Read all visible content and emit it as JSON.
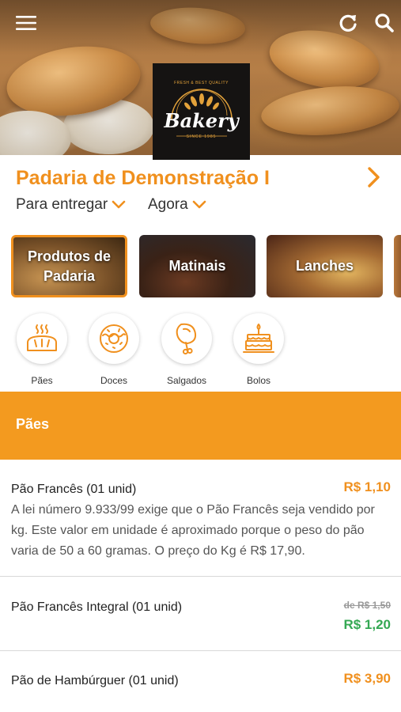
{
  "header": {
    "menu_icon": "hamburger-menu-icon",
    "refresh_icon": "refresh-icon",
    "search_icon": "search-icon",
    "logo": {
      "tagline": "FRESH & BEST QUALITY",
      "name": "Bakery",
      "since": "SINCE 1985"
    }
  },
  "store": {
    "name": "Padaria de Demonstração I",
    "delivery_mode": "Para entregar",
    "schedule": "Agora"
  },
  "categories": [
    {
      "label_line1": "Produtos de",
      "label_line2": "Padaria",
      "active": true
    },
    {
      "label_line1": "Matinais",
      "label_line2": "",
      "active": false
    },
    {
      "label_line1": "Lanches",
      "label_line2": "",
      "active": false
    }
  ],
  "subcategories": [
    {
      "label": "Pães",
      "icon": "bread-icon"
    },
    {
      "label": "Doces",
      "icon": "donut-icon"
    },
    {
      "label": "Salgados",
      "icon": "chicken-leg-icon"
    },
    {
      "label": "Bolos",
      "icon": "cake-icon"
    }
  ],
  "section": {
    "title": "Pães"
  },
  "products": [
    {
      "name": "Pão Francês (01 unid)",
      "price": "R$ 1,10",
      "description": "A lei número 9.933/99 exige que o Pão Francês seja vendido por kg. Este valor em unidade é aproximado porque o peso do pão varia de 50 a 60 gramas. O preço do Kg é R$ 17,90."
    },
    {
      "name": "Pão Francês Integral (01 unid)",
      "old_price": "de R$ 1,50",
      "price": "R$ 1,20"
    },
    {
      "name": "Pão de Hambúrguer (01 unid)",
      "price": "R$ 3,90"
    }
  ],
  "colors": {
    "accent": "#f0901e",
    "section_bar": "#f39a1f",
    "promo_price": "#34a853"
  }
}
